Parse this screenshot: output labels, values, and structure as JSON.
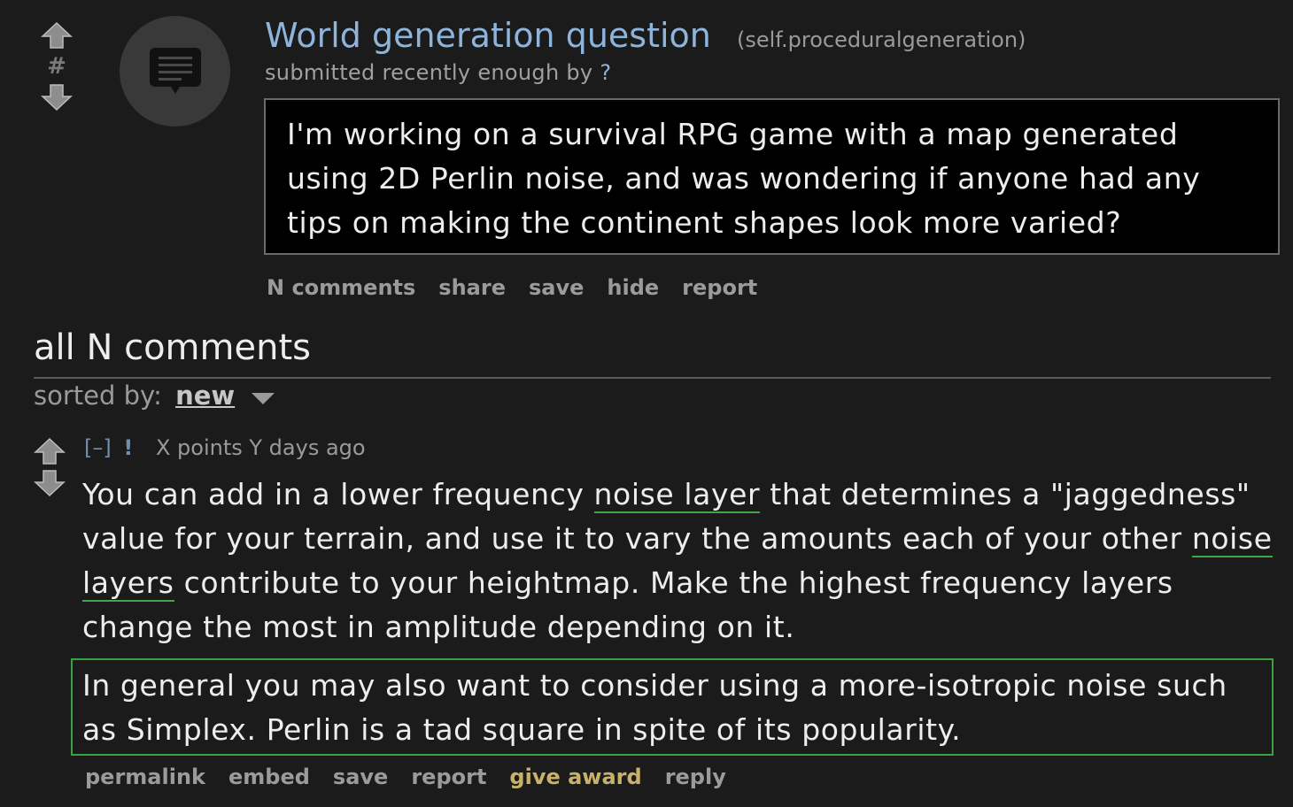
{
  "post": {
    "title": "World generation question",
    "domain": "(self.proceduralgeneration)",
    "tagline_prefix": "submitted recently enough by",
    "author": "?",
    "score": "#",
    "selftext": "I'm working on a survival RPG game with a map generated using 2D Perlin noise, and was wondering if anyone had any tips on making the continent shapes look more varied?",
    "buttons": {
      "comments": "N comments",
      "share": "share",
      "save": "save",
      "hide": "hide",
      "report": "report"
    }
  },
  "comments_area": {
    "header": "all N comments",
    "sort_label": "sorted by:",
    "sort_value": "new"
  },
  "comment": {
    "expand": "[–]",
    "author": "!",
    "meta": "X points Y days ago",
    "body_part1": "You can add in a lower frequency ",
    "link1": "noise layer",
    "body_part2": " that determines a \"jaggedness\" value for your terrain, and use it to vary the amounts each of your other ",
    "link2": "noise layers",
    "body_part3": " contribute to your heightmap. Make the highest frequency layers change the most in amplitude depending on it.",
    "quote": "In general you may also want to consider using a more-isotropic noise such as Simplex. Perlin is a tad square in spite of its popularity.",
    "buttons": {
      "permalink": "permalink",
      "embed": "embed",
      "save": "save",
      "report": "report",
      "give_award": "give award",
      "reply": "reply"
    }
  },
  "colors": {
    "background": "#1b1b1b",
    "title_link": "#8fb4db",
    "highlight_border": "#3aa243",
    "award": "#c8b26a"
  },
  "icons": {
    "upvote": "arrow-up-icon",
    "downvote": "arrow-down-icon",
    "thumbnail": "self-post-icon",
    "sort_dropdown": "chevron-down-icon"
  }
}
